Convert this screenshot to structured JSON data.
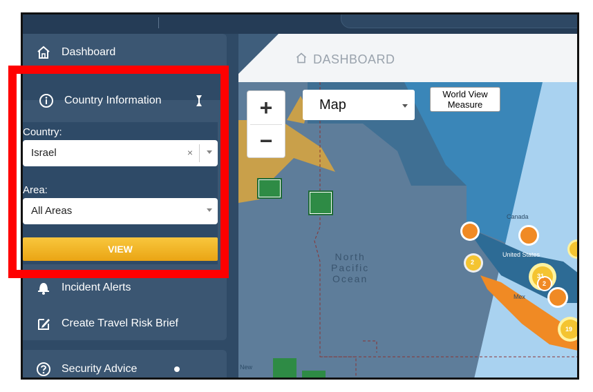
{
  "sidebar": {
    "dashboard_label": "Dashboard",
    "country_info_label": "Country Information",
    "country_field_label": "Country:",
    "country_value": "Israel",
    "clear_symbol": "×",
    "area_field_label": "Area:",
    "area_value": "All Areas",
    "view_button_label": "VIEW",
    "incident_alerts_label": "Incident Alerts",
    "travel_risk_label": "Create Travel Risk Brief",
    "security_advice_label": "Security Advice"
  },
  "main": {
    "page_title": "DASHBOARD",
    "map_type_value": "Map",
    "world_view_line1": "World View",
    "world_view_line2": "Measure",
    "zoom_in": "+",
    "zoom_out": "−",
    "ocean_label_1": "North",
    "ocean_label_2": "Pacific",
    "ocean_label_3": "Ocean",
    "canada_label": "Canada",
    "us_label": "United States",
    "mexico_label": "Mex",
    "new_label": "New",
    "cluster_counts": [
      "2",
      "31",
      "2",
      "19"
    ]
  },
  "colors": {
    "sidebar_bg": "#2f4a66",
    "card_bg": "#3b5672",
    "accent_yellow": "#f4b928",
    "highlight_red": "#ff0000",
    "marker_orange": "#f08a24"
  }
}
